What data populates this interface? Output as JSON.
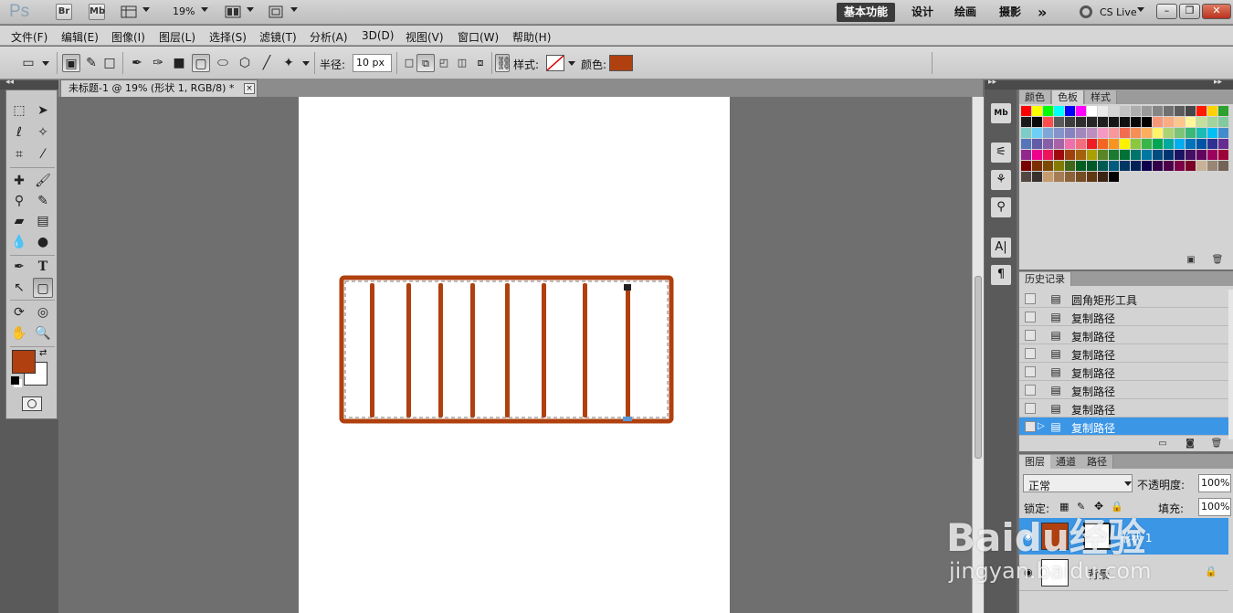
{
  "app": {
    "logo": "Ps",
    "bridge_label": "Br",
    "minibridge_label": "Mb",
    "zoom": "19%",
    "workspaces": [
      "基本功能",
      "设计",
      "绘画",
      "摄影"
    ],
    "more": "»",
    "cslive": "CS Live"
  },
  "menu": [
    "文件(F)",
    "编辑(E)",
    "图像(I)",
    "图层(L)",
    "选择(S)",
    "滤镜(T)",
    "分析(A)",
    "3D(D)",
    "视图(V)",
    "窗口(W)",
    "帮助(H)"
  ],
  "options": {
    "radius_label": "半径:",
    "radius_value": "10 px",
    "style_label": "样式:",
    "color_label": "颜色:",
    "color": "#b0400f"
  },
  "document": {
    "tab_title": "未标题-1 @ 19% (形状 1, RGB/8) *",
    "close": "×"
  },
  "toolbox": {
    "foreground": "#b0400f",
    "background": "#ffffff"
  },
  "swatches_panel": {
    "tabs": [
      "颜色",
      "色板",
      "样式"
    ],
    "active": "色板"
  },
  "history_panel": {
    "tab": "历史记录",
    "items": [
      {
        "label": "圆角矩形工具",
        "selected": false
      },
      {
        "label": "复制路径",
        "selected": false
      },
      {
        "label": "复制路径",
        "selected": false
      },
      {
        "label": "复制路径",
        "selected": false
      },
      {
        "label": "复制路径",
        "selected": false
      },
      {
        "label": "复制路径",
        "selected": false
      },
      {
        "label": "复制路径",
        "selected": false
      },
      {
        "label": "复制路径",
        "selected": true
      }
    ]
  },
  "layers_panel": {
    "tabs": [
      "图层",
      "通道",
      "路径"
    ],
    "blend_mode": "正常",
    "opacity_label": "不透明度:",
    "opacity": "100%",
    "lock_label": "锁定:",
    "fill_label": "填充:",
    "fill": "100%",
    "layers": [
      {
        "name": "形状 1",
        "selected": true
      },
      {
        "name": "背景",
        "selected": false
      }
    ]
  },
  "watermark": {
    "brand": "Baidu经验",
    "url": "jingyan.baidu.com"
  }
}
